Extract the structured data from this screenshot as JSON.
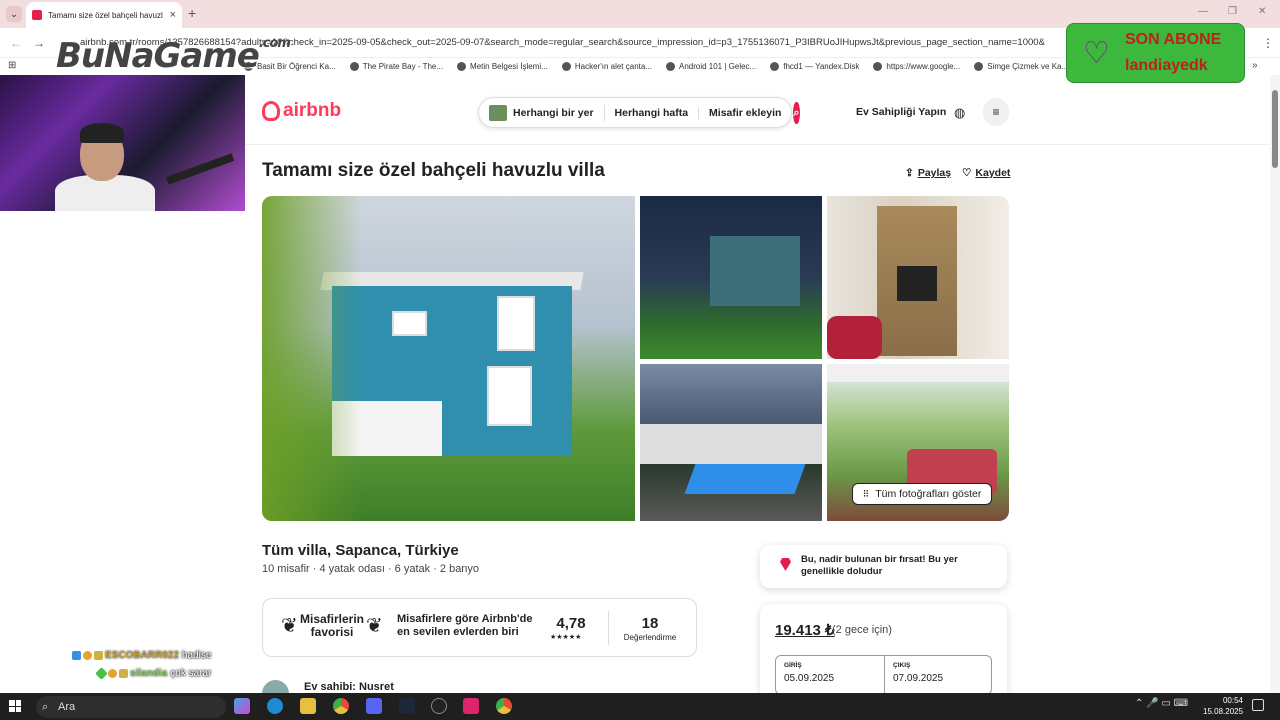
{
  "browser": {
    "tab_title": "Tamamı size özel bahçeli havuzl",
    "new_tab": "+",
    "tab_close": "×",
    "url": "airbnb.com.tr/rooms/1357826688154?adults=10&check_in=2025-09-05&check_out=2025-09-07&search_mode=regular_search&source_impression_id=p3_1755136071_P3IBRUoJIHupwsJt&previous_page_section_name=1000&",
    "bookmarks": [
      "Basit Bir Öğrenci Ka...",
      "The Pirate Bay - The...",
      "Metin Belgesi İşlemi...",
      "Hacker'ın alet çanta...",
      "Android 101 | Gelec...",
      "fhcd1 — Yandex.Disk",
      "https://www.google...",
      "Simge Çizmek ve Ka..."
    ],
    "bookmarks_more": "»"
  },
  "overlay": {
    "logo_main": "BuNaGame",
    "logo_suffix": ".com",
    "son_abone_label": "SON ABONE",
    "son_abone_user": "landiayedk",
    "chat": [
      {
        "user": "ESCOBARR022",
        "message": "hadise"
      },
      {
        "user": "silandia",
        "message": "çok sarar"
      }
    ]
  },
  "airbnb": {
    "brand": "airbnb",
    "search": {
      "where": "Herhangi bir yer",
      "when": "Herhangi hafta",
      "who": "Misafir ekleyin"
    },
    "host_link": "Ev Sahipliği Yapın",
    "listing": {
      "title": "Tamamı size özel bahçeli havuzlu villa",
      "share": "Paylaş",
      "save": "Kaydet",
      "show_all_photos": "Tüm fotoğrafları göster",
      "location": "Tüm villa, Sapanca, Türkiye",
      "specs": "10 misafir · 4 yatak odası · 6 yatak · 2 banyo",
      "guest_favorite_title": "Misafirlerin favorisi",
      "guest_favorite_desc": "Misafirlere göre Airbnb'de en sevilen evlerden biri",
      "rating": "4,78",
      "stars": "★★★★★",
      "review_count": "18",
      "review_label": "Değerlendirme",
      "host_name": "Ev sahibi: Nusret"
    },
    "booking": {
      "rare_find": "Bu, nadir bulunan bir fırsat! Bu yer genellikle doludur",
      "price": "19.413 ₺",
      "price_period": "(2 gece için)",
      "checkin_label": "GİRİŞ",
      "checkin_value": "05.09.2025",
      "checkout_label": "ÇIKIŞ",
      "checkout_value": "07.09.2025"
    }
  },
  "taskbar": {
    "search_placeholder": "Ara",
    "time": "00:54",
    "date": "15.08.2025"
  },
  "colors": {
    "airbnb_accent": "#ff385c",
    "search_button": "#e61e4d",
    "son_abone_bg": "#3cb93c",
    "tab_strip": "#f2dede"
  }
}
